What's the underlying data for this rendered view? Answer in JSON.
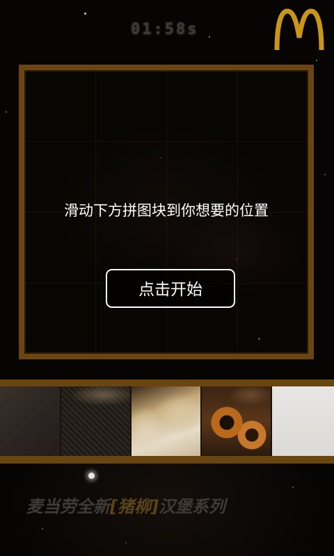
{
  "header": {
    "timer": "01:58s",
    "logo": "mcdonalds-golden-arches"
  },
  "board": {
    "instruction": "滑动下方拼图块到你想要的位置",
    "start_label": "点击开始"
  },
  "tray": {
    "pieces": [
      {
        "name": "puzzle-piece-1",
        "content": "dark background"
      },
      {
        "name": "puzzle-piece-2",
        "content": "textured fabric"
      },
      {
        "name": "puzzle-piece-3",
        "content": "burger bun"
      },
      {
        "name": "puzzle-piece-4",
        "content": "fried onion rings"
      },
      {
        "name": "puzzle-piece-5",
        "content": "white background"
      }
    ]
  },
  "footer": {
    "promo_prefix": "麦当劳全新",
    "promo_highlight": "[猪柳]",
    "promo_suffix": "汉堡系列"
  },
  "colors": {
    "frame": "#6b4510",
    "logo": "#c9951a",
    "text": "#ffffff"
  }
}
